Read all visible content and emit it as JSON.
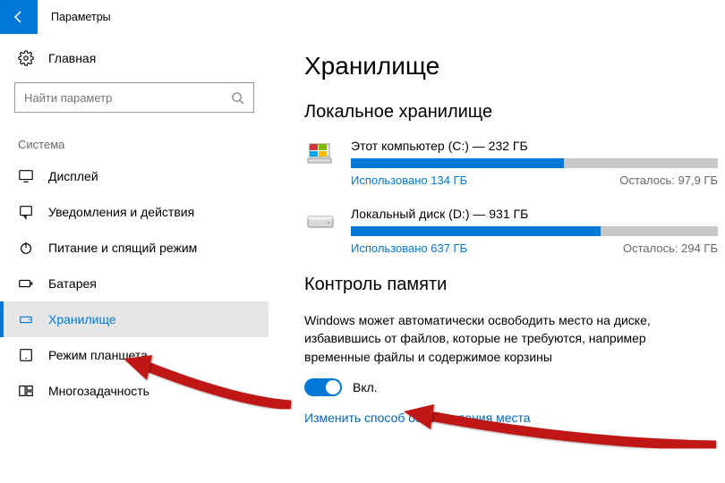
{
  "titlebar": {
    "title": "Параметры"
  },
  "sidebar": {
    "home": "Главная",
    "search_placeholder": "Найти параметр",
    "group": "Система",
    "items": [
      {
        "icon": "display-icon",
        "label": "Дисплей",
        "active": false
      },
      {
        "icon": "notification-icon",
        "label": "Уведомления и действия",
        "active": false
      },
      {
        "icon": "power-icon",
        "label": "Питание и спящий режим",
        "active": false
      },
      {
        "icon": "battery-icon",
        "label": "Батарея",
        "active": false
      },
      {
        "icon": "storage-icon",
        "label": "Хранилище",
        "active": true
      },
      {
        "icon": "tablet-icon",
        "label": "Режим планшета",
        "active": false
      },
      {
        "icon": "multitask-icon",
        "label": "Многозадачность",
        "active": false
      }
    ]
  },
  "main": {
    "heading": "Хранилище",
    "local_heading": "Локальное хранилище",
    "drives": [
      {
        "title": "Этот компьютер (C:) — 232 ГБ",
        "used": "Использовано 134 ГБ",
        "remaining": "Осталось: 97,9 ГБ",
        "percent": 58,
        "icon": "pc"
      },
      {
        "title": "Локальный диск (D:) — 931 ГБ",
        "used": "Использовано 637 ГБ",
        "remaining": "Осталось: 294 ГБ",
        "percent": 68,
        "icon": "hdd"
      }
    ],
    "storage_sense": {
      "heading": "Контроль памяти",
      "desc": "Windows может автоматически освободить место на диске, избавившись от файлов, которые не требуются, например временные файлы и содержимое корзины",
      "state": "Вкл.",
      "link": "Изменить способ освобождения места"
    }
  }
}
